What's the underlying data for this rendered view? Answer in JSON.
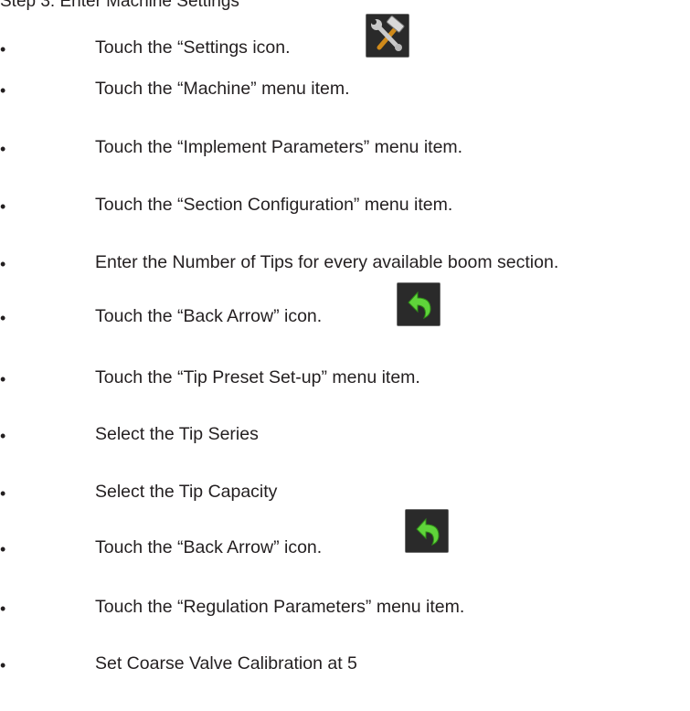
{
  "heading": "Step 3: Enter Machine Settings",
  "bullet_char": "•",
  "steps": [
    {
      "text": "Touch the “Settings icon."
    },
    {
      "text": "Touch the “Machine” menu item."
    },
    {
      "text": "Touch the “Implement Parameters” menu item."
    },
    {
      "text": "Touch the “Section Configuration” menu item."
    },
    {
      "text": "Enter the Number of Tips for every available boom section."
    },
    {
      "text": "Touch the “Back Arrow” icon."
    },
    {
      "text": "Touch the “Tip Preset Set-up” menu item."
    },
    {
      "text": "Select the Tip Series"
    },
    {
      "text": "Select the Tip Capacity"
    },
    {
      "text": "Touch the “Back Arrow” icon."
    },
    {
      "text": "Touch the “Regulation Parameters” menu item."
    },
    {
      "text": "Set Coarse Valve Calibration at 5"
    }
  ],
  "icons": {
    "settings": "settings-tools-icon",
    "back": "back-arrow-icon"
  },
  "colors": {
    "text": "#231f20",
    "icon_bg": "#2b2b2b",
    "arrow_green": "#5fd43a"
  }
}
